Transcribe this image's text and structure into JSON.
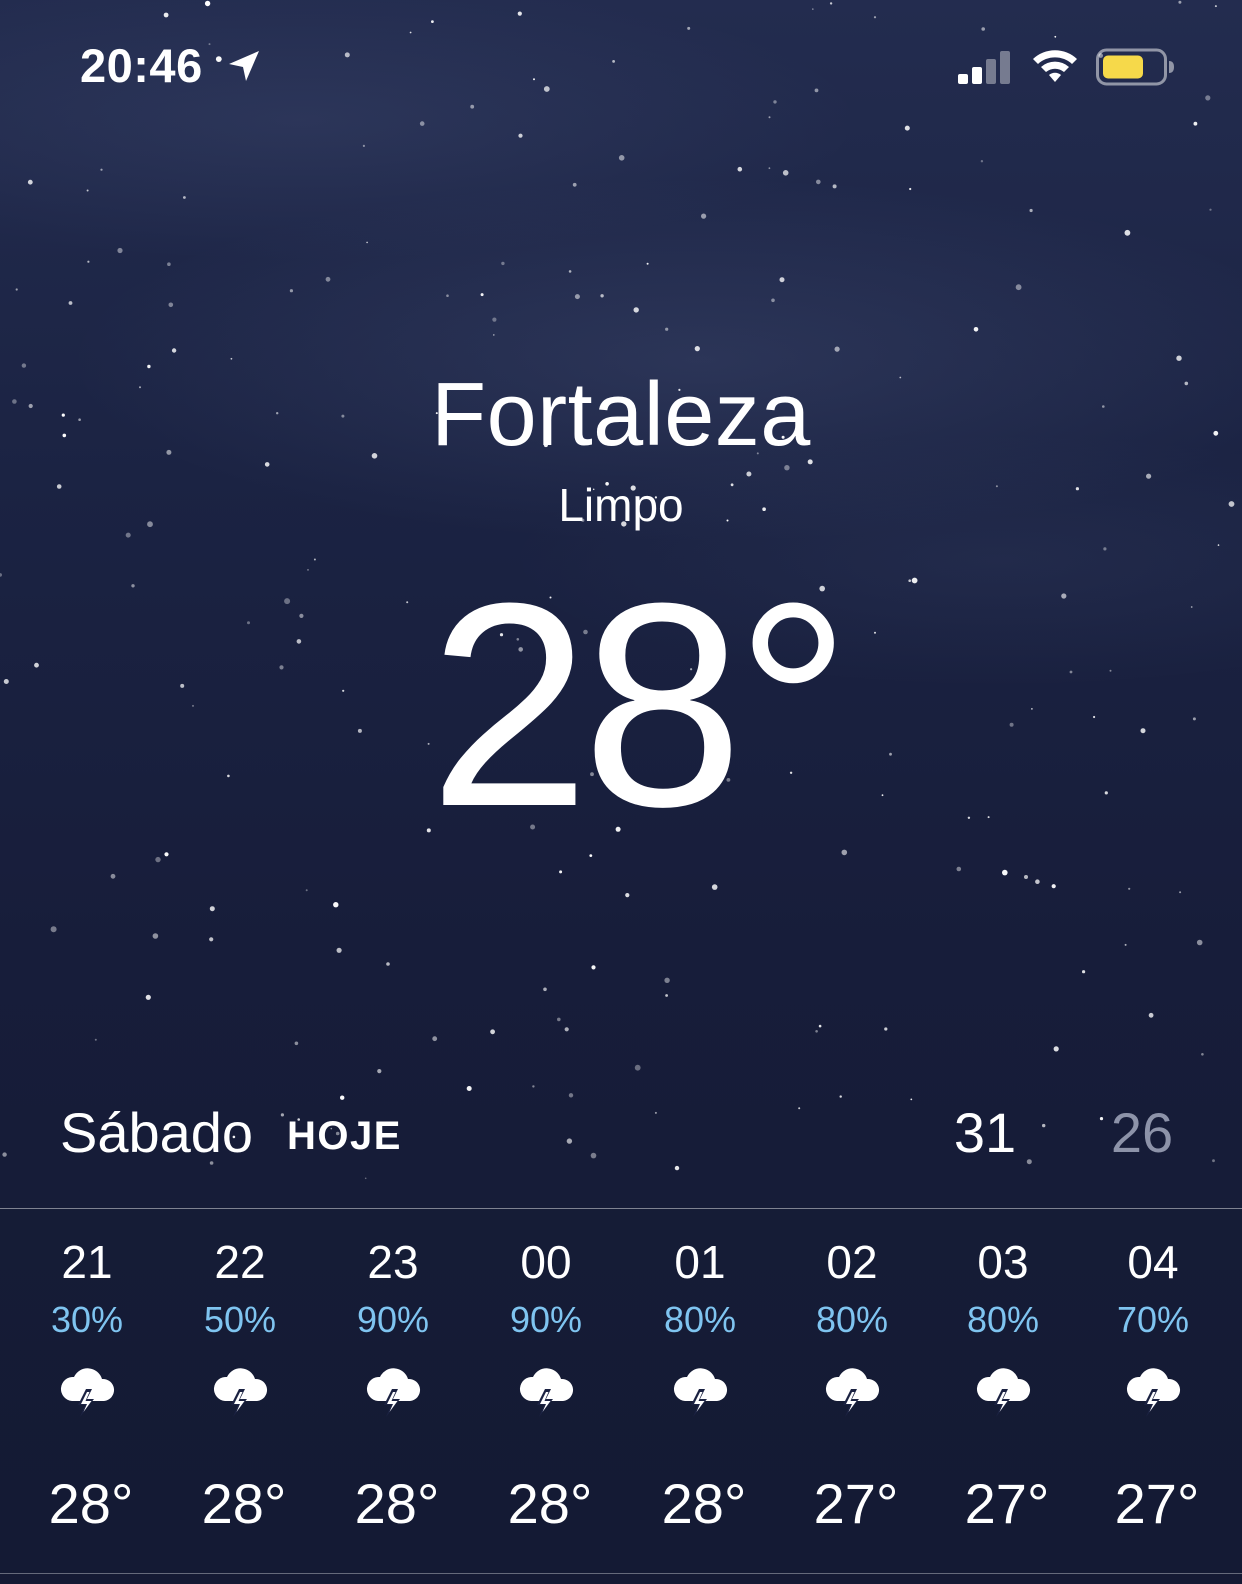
{
  "status_bar": {
    "time": "20:46",
    "location_icon": "location-arrow-icon",
    "signal_icon": "cellular-signal-icon",
    "wifi_icon": "wifi-icon",
    "battery_icon": "battery-icon",
    "battery_color": "#f6d94a"
  },
  "current": {
    "city": "Fortaleza",
    "condition": "Limpo",
    "temperature": "28",
    "degree": "°"
  },
  "today": {
    "day_name": "Sábado",
    "badge": "HOJE",
    "high": "31",
    "low": "26"
  },
  "colors": {
    "chance_of_rain": "#7fc4f0",
    "low_temp": "#8d93a9"
  },
  "hourly": [
    {
      "hour": "21",
      "chance": "30%",
      "icon": "thunderstorm-icon",
      "temp": "28°"
    },
    {
      "hour": "22",
      "chance": "50%",
      "icon": "thunderstorm-icon",
      "temp": "28°"
    },
    {
      "hour": "23",
      "chance": "90%",
      "icon": "thunderstorm-icon",
      "temp": "28°"
    },
    {
      "hour": "00",
      "chance": "90%",
      "icon": "thunderstorm-icon",
      "temp": "28°"
    },
    {
      "hour": "01",
      "chance": "80%",
      "icon": "thunderstorm-icon",
      "temp": "28°"
    },
    {
      "hour": "02",
      "chance": "80%",
      "icon": "thunderstorm-icon",
      "temp": "27°"
    },
    {
      "hour": "03",
      "chance": "80%",
      "icon": "thunderstorm-icon",
      "temp": "27°"
    },
    {
      "hour": "04",
      "chance": "70%",
      "icon": "thunderstorm-icon",
      "temp": "27°"
    }
  ]
}
